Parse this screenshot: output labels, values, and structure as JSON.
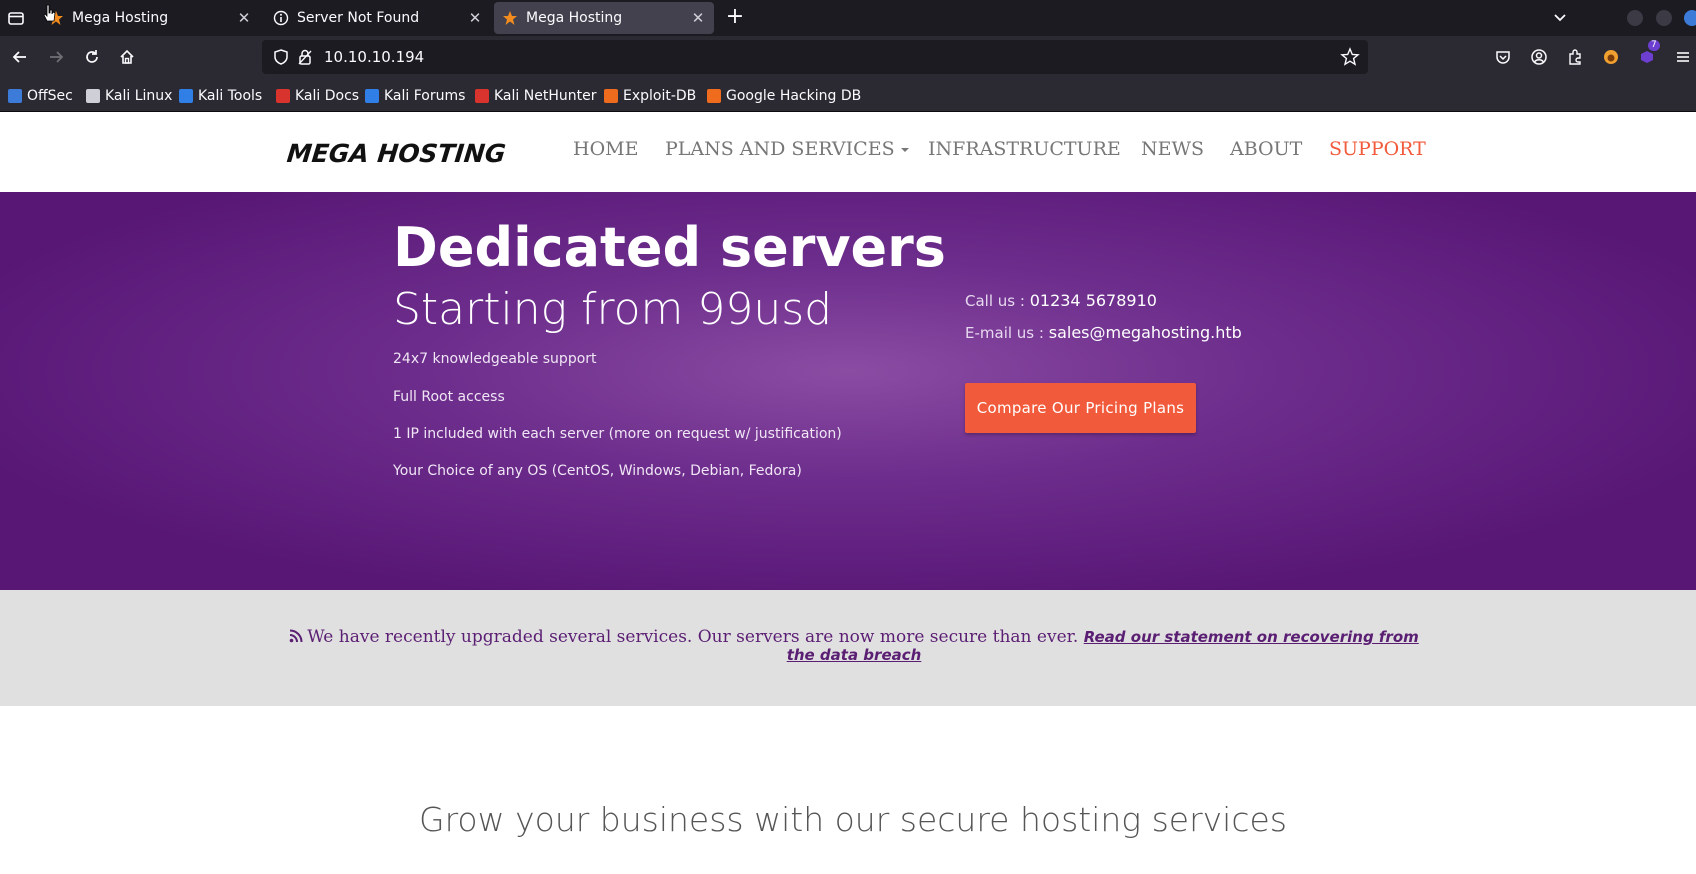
{
  "browser": {
    "tabs": [
      {
        "title": "Mega Hosting",
        "favicon": "star-icon",
        "active": false
      },
      {
        "title": "Server Not Found",
        "favicon": "info-icon",
        "active": false
      },
      {
        "title": "Mega Hosting",
        "favicon": "star-icon",
        "active": true
      }
    ],
    "address": "10.10.10.194",
    "extension_badge": "7",
    "bookmarks": [
      {
        "label": "OffSec",
        "color": "#3d7bd9"
      },
      {
        "label": "Kali Linux",
        "color": "#cfcfd8"
      },
      {
        "label": "Kali Tools",
        "color": "#2f7fe6"
      },
      {
        "label": "Kali Docs",
        "color": "#d8332c"
      },
      {
        "label": "Kali Forums",
        "color": "#2f7fe6"
      },
      {
        "label": "Kali NetHunter",
        "color": "#d8332c"
      },
      {
        "label": "Exploit-DB",
        "color": "#ef6b1e"
      },
      {
        "label": "Google Hacking DB",
        "color": "#ef6b1e"
      }
    ]
  },
  "site": {
    "logo": "MEGA HOSTING",
    "menu": {
      "home": "HOME",
      "plans": "PLANS AND SERVICES",
      "infrastructure": "INFRASTRUCTURE",
      "news": "NEWS",
      "about": "ABOUT",
      "support": "SUPPORT"
    },
    "hero": {
      "title": "Dedicated servers",
      "subtitle": "Starting from 99usd",
      "features": [
        "24x7 knowledgeable support",
        "Full Root access",
        "1 IP included with each server (more on request w/ justification)",
        "Your Choice of any OS (CentOS, Windows, Debian, Fedora)"
      ],
      "call_label": "Call us :",
      "call_value": "01234 5678910",
      "email_label": "E-mail us :",
      "email_value": "sales@megahosting.htb",
      "cta": "Compare Our Pricing Plans"
    },
    "notice": {
      "text": "We have recently upgraded several services. Our servers are now more secure than ever.",
      "link": "Read our statement on recovering from the data breach"
    },
    "section_title": "Grow your business with our secure hosting services"
  },
  "colors": {
    "accent": "#f15a3a",
    "hero": "#6d2d8c",
    "notice_text": "#5a1e73"
  }
}
